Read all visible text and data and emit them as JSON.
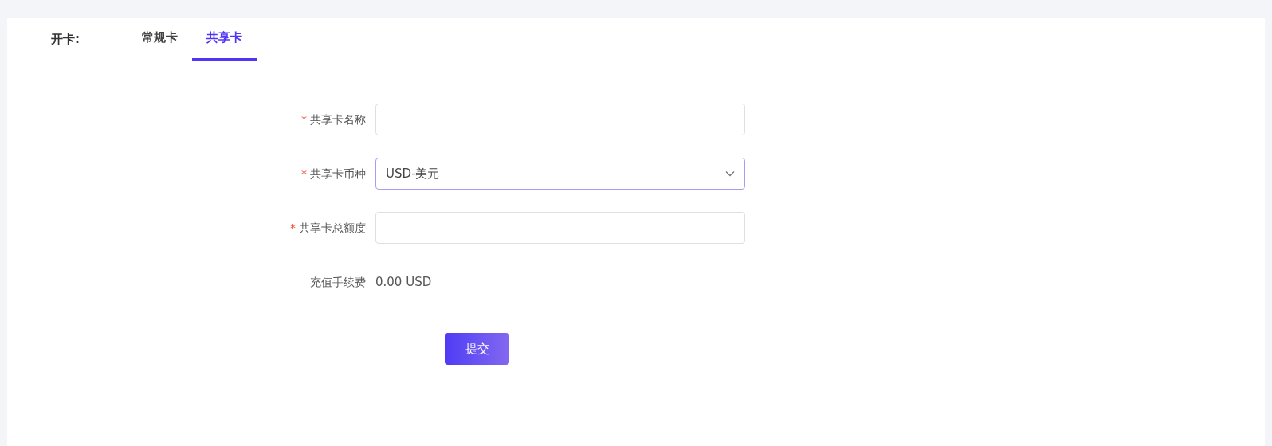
{
  "tabs_label": "开卡:",
  "tabs": [
    {
      "label": "常规卡",
      "selected": false
    },
    {
      "label": "共享卡",
      "selected": true
    }
  ],
  "form": {
    "fields": [
      {
        "kind": "input",
        "label": "共享卡名称",
        "required_mark": "*",
        "focused": false
      },
      {
        "kind": "select",
        "label": "共享卡币种",
        "required_mark": "*",
        "focused": true,
        "value": "USD-美元"
      },
      {
        "kind": "input",
        "label": "共享卡总额度",
        "required_mark": "*",
        "focused": false
      },
      {
        "kind": "text",
        "label": "充值手续费",
        "value": "0.00 USD"
      }
    ],
    "submit": "提交"
  }
}
